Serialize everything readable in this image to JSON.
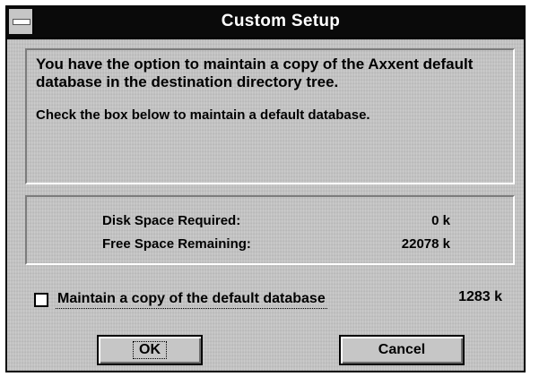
{
  "window": {
    "title": "Custom Setup"
  },
  "description": {
    "line1": "You have the option to maintain a copy of the Axxent default database in the destination directory tree.",
    "line2": "Check the box below to maintain a default database."
  },
  "disk_space": {
    "required_label": "Disk Space Required:",
    "required_value": "0 k",
    "remaining_label": "Free Space Remaining:",
    "remaining_value": "22078 k"
  },
  "option": {
    "checkbox_label": "Maintain a copy of the default database",
    "checked": false,
    "size": "1283 k"
  },
  "buttons": {
    "ok": "OK",
    "cancel": "Cancel"
  }
}
